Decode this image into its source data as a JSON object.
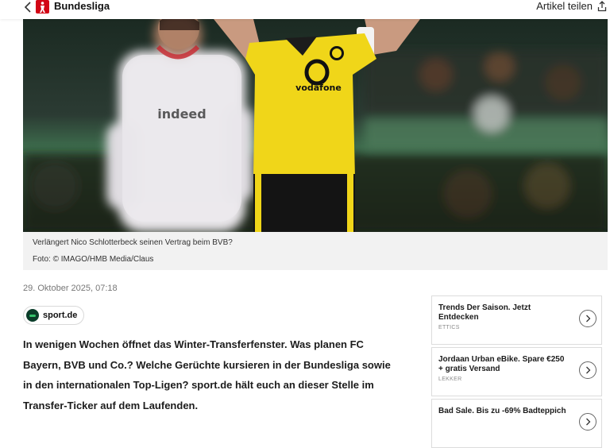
{
  "header": {
    "brand": "Bundesliga",
    "share_label": "Artikel teilen"
  },
  "hero": {
    "caption": "Verlängert Nico Schlotterbeck seinen Vertrag beim BVB?",
    "credit": "Foto: © IMAGO/HMB Media/Claus",
    "shirt_text_left": "indeed",
    "shirt_sponsor_right": "vodafone"
  },
  "article": {
    "date": "29. Oktober 2025, 07:18",
    "source": "sport.de",
    "lead": "In wenigen Wochen öffnet das Winter-Transferfenster. Was planen FC Bayern, BVB und Co.? Welche Gerüchte kursieren in der Bundesliga sowie in den internationalen Top-Ligen? sport.de hält euch an dieser Stelle im Transfer-Ticker auf dem Laufenden."
  },
  "ads": [
    {
      "title": "Trends Der Saison. Jetzt Entdecken",
      "sponsor": "ETTICS"
    },
    {
      "title": "Jordaan Urban eBike. Spare €250 + gratis Versand",
      "sponsor": "LEKKER"
    },
    {
      "title": "Bad Sale. Bis zu -69% Badteppich",
      "sponsor": ""
    }
  ],
  "colors": {
    "accent_red": "#d20515",
    "bvb_yellow": "#f0d619",
    "caption_bg": "#f2f2f2"
  }
}
